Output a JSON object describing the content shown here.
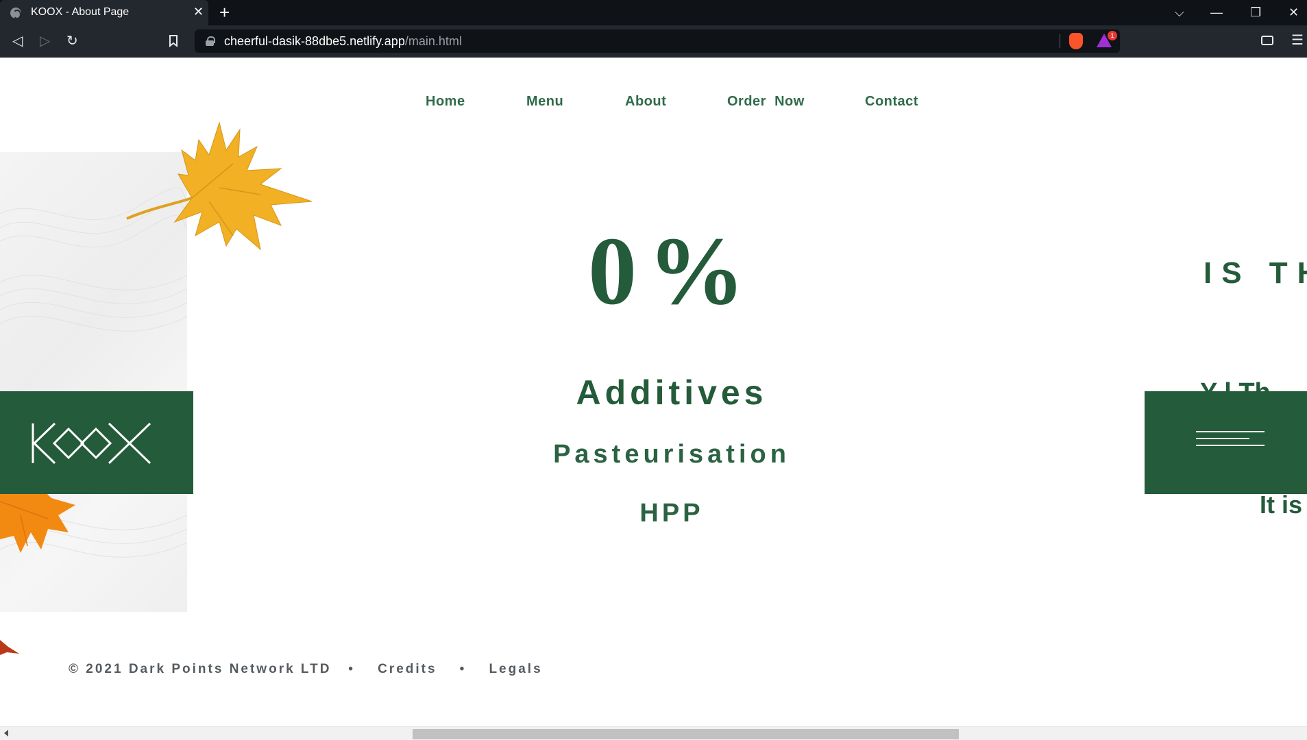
{
  "browser": {
    "tab_title": "KOOX - About Page",
    "tab_close": "✕",
    "new_tab": "+",
    "url_host": "cheerful-dasik-88dbe5.netlify.app",
    "url_path": "/main.html",
    "rewards_badge": "1",
    "window_controls": {
      "tab_search": "⌵",
      "minimize": "—",
      "restore": "❐",
      "close": "✕"
    },
    "nav": {
      "back": "◁",
      "forward": "▷",
      "reload": "↻",
      "bookmark": "🔖"
    },
    "menu": "☰"
  },
  "site": {
    "nav": [
      "Home",
      "Menu",
      "About",
      "Order  Now",
      "Contact"
    ],
    "hero": {
      "percent": "0%",
      "items": [
        "Additives",
        "Pasteurisation",
        "HPP"
      ]
    },
    "right": {
      "heading": "IS TH",
      "sub": "Y    l Th",
      "line": "It is"
    },
    "footer": {
      "copyright": "© 2021 Dark Points Network LTD",
      "separator": "•",
      "credits": "Credits",
      "legals": "Legals"
    }
  },
  "colors": {
    "brand_green": "#245b3a",
    "nav_text": "#2f6b4a",
    "leaf_yellow": "#f2b024",
    "leaf_orange": "#f28a12"
  },
  "icons": [
    "globe-icon",
    "lock-icon",
    "brave-shield-icon",
    "rewards-triangle-icon",
    "wallet-icon",
    "hamburger-icon",
    "koox-logo"
  ]
}
